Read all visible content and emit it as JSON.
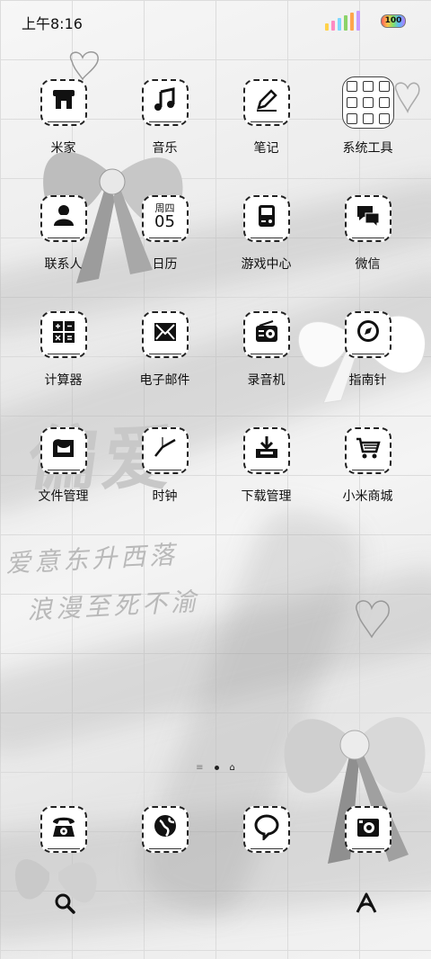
{
  "status_bar": {
    "time": "上午8:16",
    "battery": "100",
    "signal_colors": [
      "#ffd24a",
      "#ff8ac2",
      "#7fd8ff",
      "#8bd36a",
      "#ffa64d",
      "#c89bff"
    ]
  },
  "wallpaper": {
    "line1": "爱意东升西落",
    "line2": "浪漫至死不渝",
    "big_text": "偏爱"
  },
  "apps": [
    {
      "label": "米家",
      "icon": "mi-home-icon"
    },
    {
      "label": "音乐",
      "icon": "music-icon"
    },
    {
      "label": "笔记",
      "icon": "notes-icon"
    },
    {
      "label": "系统工具",
      "icon": "folder-icon"
    },
    {
      "label": "联系人",
      "icon": "contacts-icon"
    },
    {
      "label": "日历",
      "icon": "calendar-icon",
      "day": "周四",
      "date": "05"
    },
    {
      "label": "游戏中心",
      "icon": "game-icon"
    },
    {
      "label": "微信",
      "icon": "wechat-icon"
    },
    {
      "label": "计算器",
      "icon": "calculator-icon"
    },
    {
      "label": "电子邮件",
      "icon": "email-icon"
    },
    {
      "label": "录音机",
      "icon": "recorder-icon"
    },
    {
      "label": "指南针",
      "icon": "compass-icon"
    },
    {
      "label": "文件管理",
      "icon": "file-manager-icon"
    },
    {
      "label": "时钟",
      "icon": "clock-icon"
    },
    {
      "label": "下载管理",
      "icon": "download-icon"
    },
    {
      "label": "小米商城",
      "icon": "shopping-cart-icon"
    }
  ],
  "dock": [
    {
      "icon": "phone-icon"
    },
    {
      "icon": "browser-icon"
    },
    {
      "icon": "messages-icon"
    },
    {
      "icon": "camera-icon"
    }
  ],
  "pager": {
    "pages": "≡ • ⌂"
  }
}
